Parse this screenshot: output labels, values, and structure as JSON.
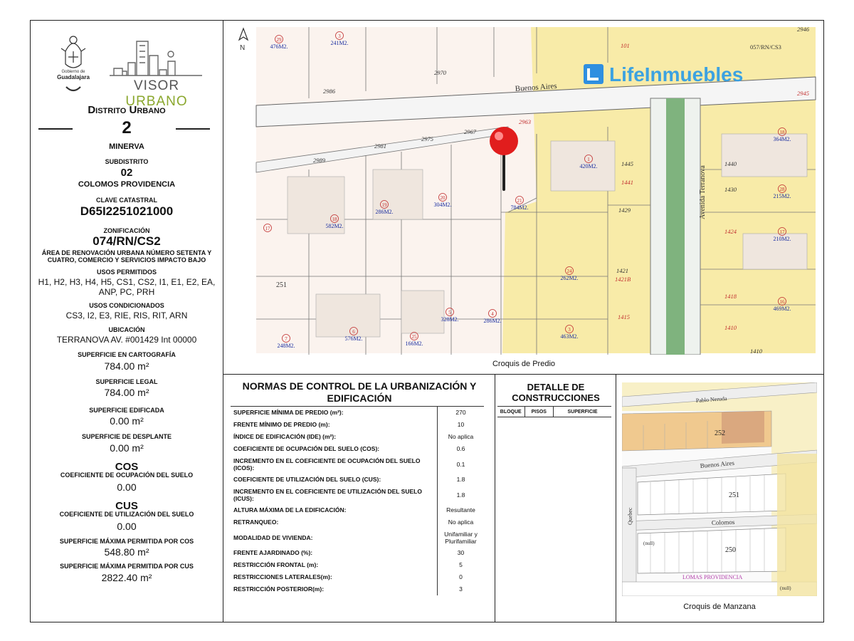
{
  "header": {
    "gdl_logo_text": "Gobierno de Guadalajara",
    "visor_part1": "VISOR ",
    "visor_part2": "URBANO"
  },
  "left": {
    "distrito_label": "Distrito Urbano",
    "distrito_num": "2",
    "distrito_name": "MINERVA",
    "subdistrito_label": "SUBDISTRITO",
    "subdistrito_num": "02",
    "subdistrito_name": "COLOMOS PROVIDENCIA",
    "clave_label": "CLAVE CATASTRAL",
    "clave": "D65I2251021000",
    "zon_label": "ZONIFICACIÓN",
    "zon": "074/RN/CS2",
    "zon_desc": "ÁREA DE RENOVACIÓN URBANA NÚMERO SETENTA Y CUATRO, COMERCIO Y SERVICIOS IMPACTO BAJO",
    "usos_perm_label": "USOS PERMITIDOS",
    "usos_perm": "H1, H2, H3, H4, H5, CS1, CS2, I1, E1, E2, EA, ANP, PC, PRH",
    "usos_cond_label": "USOS CONDICIONADOS",
    "usos_cond": "CS3, I2, E3, RIE, RIS, RIT, ARN",
    "ubic_label": "UBICACIÓN",
    "ubic": "TERRANOVA AV. #001429 Int 00000",
    "sup_cart_label": "SUPERFICIE EN CARTOGRAFÍA",
    "sup_cart": "784.00 m²",
    "sup_legal_label": "SUPERFICIE LEGAL",
    "sup_legal": "784.00 m²",
    "sup_edif_label": "SUPERFICIE EDIFICADA",
    "sup_edif": "0.00 m²",
    "sup_desp_label": "SUPERFICIE DE DESPLANTE",
    "sup_desp": "0.00 m²",
    "cos_title": "COS",
    "cos_label": "COEFICIENTE DE OCUPACIÓN DEL SUELO",
    "cos": "0.00",
    "cus_title": "CUS",
    "cus_label": "COEFICIENTE DE UTILIZACIÓN DEL SUELO",
    "cus": "0.00",
    "max_cos_label": "SUPERFICIE MÁXIMA PERMITIDA POR COS",
    "max_cos": "548.80 m²",
    "max_cus_label": "SUPERFICIE MÁXIMA PERMITIDA POR CUS",
    "max_cus": "2822.40 m²"
  },
  "map": {
    "caption": "Croquis de Predio",
    "north": "N",
    "brand": "LifeInmuebles",
    "streets": [
      "Buenos Aires",
      "Avenida Terranova"
    ],
    "numbers": [
      "2946",
      "2970",
      "2986",
      "2945",
      "2963",
      "2967",
      "2975",
      "2981",
      "2989",
      "1445",
      "1441",
      "1429",
      "1440",
      "1430",
      "1424",
      "1421",
      "1421B",
      "1418",
      "1415",
      "1410",
      "251",
      "101",
      "057/RN/CS3"
    ],
    "lots": [
      {
        "n": "29",
        "a": "476M2."
      },
      {
        "n": "3",
        "a": "241M2."
      },
      {
        "n": "1",
        "a": "420M2."
      },
      {
        "n": "18",
        "a": "364M2."
      },
      {
        "n": "28",
        "a": "215M2."
      },
      {
        "n": "17",
        "a": "210M2."
      },
      {
        "n": "16",
        "a": "469M2."
      },
      {
        "n": "18",
        "a": "582M2."
      },
      {
        "n": "19",
        "a": "286M2."
      },
      {
        "n": "20",
        "a": "304M2."
      },
      {
        "n": "21",
        "a": "784M2."
      },
      {
        "n": "24",
        "a": "262M2."
      },
      {
        "n": "3",
        "a": "463M2."
      },
      {
        "n": "4",
        "a": "286M2."
      },
      {
        "n": "5",
        "a": "328M2."
      },
      {
        "n": "25",
        "a": "166M2."
      },
      {
        "n": "6",
        "a": "576M2."
      },
      {
        "n": "7",
        "a": "248M2."
      },
      {
        "n": "17",
        "a": ""
      }
    ]
  },
  "norms": {
    "title": "NORMAS DE CONTROL DE LA URBANIZACIÓN Y EDIFICACIÓN",
    "rows": [
      {
        "k": "SUPERFICIE MÍNIMA DE PREDIO (m²):",
        "v": "270"
      },
      {
        "k": "FRENTE MÍNIMO DE PREDIO (m):",
        "v": "10"
      },
      {
        "k": "ÍNDICE DE EDIFICACIÓN (IDE) (m²):",
        "v": "No aplica"
      },
      {
        "k": "COEFICIENTE DE OCUPACIÓN DEL SUELO (COS):",
        "v": "0.6"
      },
      {
        "k": "INCREMENTO EN EL COEFICIENTE DE OCUPACIÓN DEL SUELO (ICOS):",
        "v": "0.1"
      },
      {
        "k": "COEFICIENTE DE UTILIZACIÓN DEL SUELO (CUS):",
        "v": "1.8"
      },
      {
        "k": "INCREMENTO EN EL COEFICIENTE DE UTILIZACIÓN DEL SUELO (ICUS):",
        "v": "1.8"
      },
      {
        "k": "ALTURA MÁXIMA DE LA EDIFICACIÓN:",
        "v": "Resultante"
      },
      {
        "k": "RETRANQUEO:",
        "v": "No aplica"
      },
      {
        "k": "MODALIDAD DE VIVIENDA:",
        "v": "Unifamiliar y Plurifamiliar"
      },
      {
        "k": "FRENTE AJARDINADO (%):",
        "v": "30"
      },
      {
        "k": "RESTRICCIÓN FRONTAL (m):",
        "v": "5"
      },
      {
        "k": "RESTRICCIONES LATERALES(m):",
        "v": "0"
      },
      {
        "k": "RESTRICCIÓN POSTERIOR(m):",
        "v": "3"
      }
    ]
  },
  "detail": {
    "title": "DETALLE DE CONSTRUCCIONES",
    "cols": [
      "BLOQUE",
      "PISOS",
      "SUPERFICIE"
    ]
  },
  "manzana": {
    "caption": "Croquis de Manzana",
    "streets": [
      "Pablo Neruda",
      "Buenos Aires",
      "Colomos",
      "Quebec"
    ],
    "blocks": [
      "252",
      "251",
      "250"
    ],
    "labels": [
      "(null)",
      "(null)",
      "LOMAS PROVIDENCIA"
    ]
  }
}
